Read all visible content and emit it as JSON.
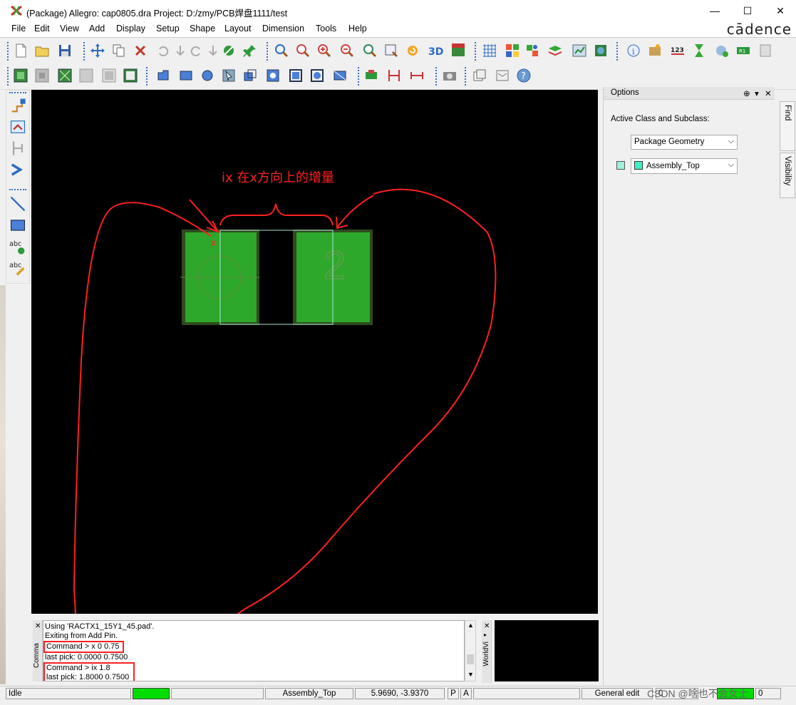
{
  "window": {
    "title": "(Package) Allegro: cap0805.dra  Project: D:/zmy/PCB焊盘1111/test",
    "controls": [
      "—",
      "☐",
      "✕"
    ]
  },
  "menu": [
    "File",
    "Edit",
    "View",
    "Add",
    "Display",
    "Setup",
    "Shape",
    "Layout",
    "Dimension",
    "Tools",
    "Help"
  ],
  "brand": "cādence",
  "toolbar_row1_icons": [
    "new-file-icon",
    "open-folder-icon",
    "save-icon",
    "move-icon",
    "copy-icon",
    "delete-icon",
    "undo-icon",
    "undo-step-icon",
    "redo-icon",
    "redo-step-icon",
    "shape-edit-icon",
    "pin-icon",
    "zoom-fit-icon",
    "zoom-window-icon",
    "zoom-in-icon",
    "zoom-out-icon",
    "zoom-previous-icon",
    "zoom-world-icon",
    "redraw-icon",
    "3d-view-icon",
    "flip-view-icon",
    "grid-icon",
    "color-icon",
    "layer-visibility-icon",
    "layer-icon",
    "stats-icon",
    "world-icon",
    "info-icon",
    "measure-icon",
    "numbering-icon",
    "hourglass-icon",
    "db-doctor-icon",
    "refdes-icon",
    "off-grid-icon"
  ],
  "toolbar_row2_icons": [
    "place-green-icon",
    "place-gray-icon",
    "place-pattern-icon",
    "gray-box-icon",
    "gray-frame-icon",
    "green-frame-icon",
    "shape-add-icon",
    "rectangle-icon",
    "circle-icon",
    "select-icon",
    "shape-merge-icon",
    "shape-void-icon",
    "frame-icon",
    "circle-frame-icon",
    "shape-fill-icon",
    "snap-icon",
    "dim-icon",
    "dim-linear-icon",
    "camera-icon",
    "database-icon",
    "report-icon",
    "help-icon"
  ],
  "left_toolbar_icons": [
    "add-pin-icon",
    "edit-pin-icon",
    "pin-route-icon",
    "swap-icon",
    "line-icon",
    "rectangle-icon",
    "add-text-icon",
    "edit-text-icon"
  ],
  "canvas": {
    "pin2_label": "2",
    "x_marker": "x",
    "annotation": "ix 在x方向上的增量"
  },
  "options_panel": {
    "title": "Options",
    "label": "Active Class and Subclass:",
    "class_value": "Package Geometry",
    "subclass_value": "Assembly_Top",
    "subclass_color": "#3ef0c8"
  },
  "side_tabs": [
    "Find",
    "Visibility"
  ],
  "command_panel": {
    "tab_label": "Comma",
    "lines": [
      "Using 'RACTX1_15Y1_45.pad'.",
      "Exiting from Add Pin.",
      "Command > x 0 0.75",
      "last pick:  0.0000 0.7500",
      "Command > ix 1.8",
      "last pick:  1.8000 0.7500"
    ]
  },
  "world_view": {
    "tab_label": "WorldVi"
  },
  "status": {
    "state": "Idle",
    "subclass": "Assembly_Top",
    "coords": "5.9690, -3.9370",
    "p": "P",
    "a": "A",
    "mode": "General edit",
    "off": "0",
    "count": "0",
    "watermark": "CSDN @啥也不会女士"
  }
}
